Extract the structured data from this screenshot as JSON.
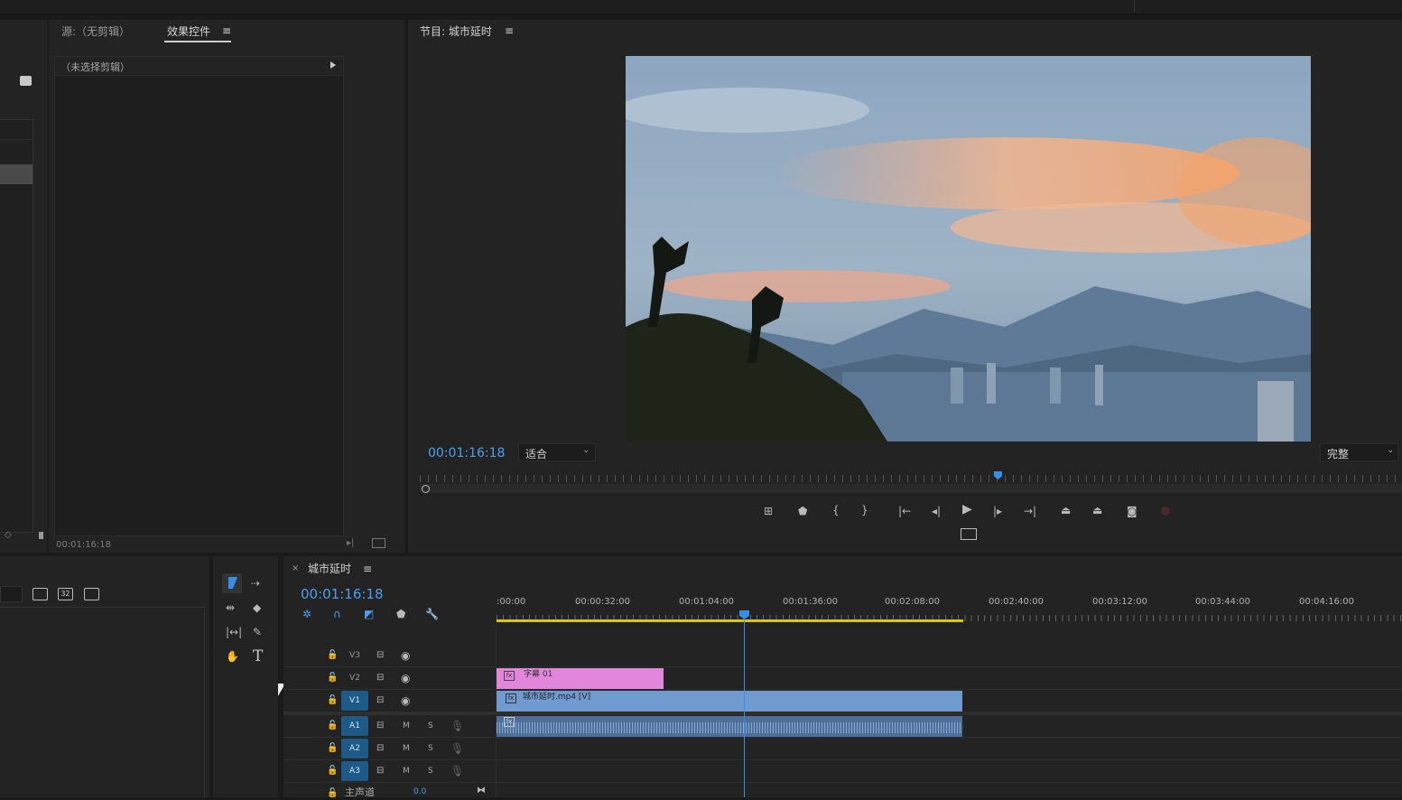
{
  "colors": {
    "accent": "#2d8ceb",
    "timecode": "#4aa0f0",
    "bg_panel": "#232323",
    "playhead": "#3a8ee6",
    "work_area": "#d8c900",
    "caption_clip": "#e186db",
    "video_clip": "#6f9bd1",
    "audio_clip": "#4e6f99",
    "track_active": "#1e5a88",
    "record_dot": "#4a2a2a"
  },
  "effect_controls": {
    "tab_source": "源:（无剪辑）",
    "tab_effects": "效果控件",
    "menu_icon": "≡",
    "no_clip": "（未选择剪辑）",
    "timecode": "00:01:16:18"
  },
  "program_monitor": {
    "title": "节目: 城市延时",
    "menu_icon": "≡",
    "timecode": "00:01:16:18",
    "fit_value": "适合",
    "quality_value": "完整"
  },
  "timeline": {
    "close": "×",
    "title": "城市延时",
    "menu_icon": "≡",
    "timecode": "00:01:16:18",
    "ruler_labels": [
      ":00:00",
      "00:00:32:00",
      "00:01:04:00",
      "00:01:36:00",
      "00:02:08:00",
      "00:02:40:00",
      "00:03:12:00",
      "00:03:44:00",
      "00:04:16:00"
    ],
    "tracks": {
      "v3": "V3",
      "v2": "V2",
      "v1": "V1",
      "a1": "A1",
      "a2": "A2",
      "a3": "A3",
      "mute": "M",
      "solo": "S",
      "master": "主声道",
      "master_value": "0.0"
    },
    "clips": {
      "caption": "字幕 01",
      "video": "城市延时.mp4 [V]",
      "fx": "fx"
    }
  },
  "project_panel": {
    "icon_a": "32"
  },
  "tools": {
    "type_tool": "T"
  }
}
